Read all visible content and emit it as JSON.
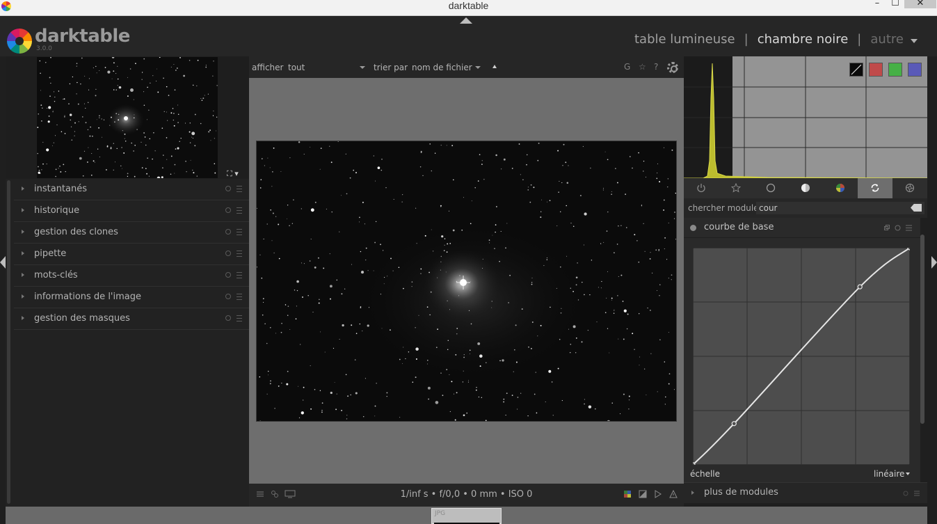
{
  "window": {
    "title": "darktable",
    "controls": [
      "minimize-icon",
      "maximize-icon",
      "close-icon"
    ]
  },
  "header": {
    "app_name": "darktable",
    "version": "3.0.0",
    "views": {
      "lighttable": "table lumineuse",
      "darkroom": "chambre noire",
      "other": "autre",
      "separator": "|"
    },
    "active_view": "chambre noire"
  },
  "left_modules": [
    {
      "label": "instantanés"
    },
    {
      "label": "historique"
    },
    {
      "label": "gestion des clones"
    },
    {
      "label": "pipette"
    },
    {
      "label": "mots-clés"
    },
    {
      "label": "informations de l'image"
    },
    {
      "label": "gestion des masques"
    }
  ],
  "toolbar_top": {
    "show_label": "afficher",
    "show_value": "tout",
    "sort_label": "trier par",
    "sort_value": "nom de fichier",
    "grouping_icon_text": "G",
    "star_icon_text": "☆",
    "help_icon_text": "?"
  },
  "toolbar_bottom": {
    "exif": "1/inf s • f/0,0 • 0 mm • ISO 0"
  },
  "histogram": {
    "channel_buttons": [
      "linear-log-icon",
      "red-channel",
      "green-channel",
      "blue-channel"
    ],
    "colors": {
      "red": "#c04a4a",
      "green": "#46b046",
      "blue": "#5a5ab8",
      "fill": "#bcbc2e"
    }
  },
  "module_groups": [
    "power-icon",
    "star-icon",
    "circle-icon",
    "tone-icon",
    "color-icon",
    "correct-icon",
    "effect-icon"
  ],
  "active_group": 5,
  "search": {
    "label": "chercher module",
    "value": "cour"
  },
  "curve_module": {
    "title": "courbe de base",
    "scale_label": "échelle",
    "scale_value": "linéaire",
    "curve_points": [
      [
        0,
        0
      ],
      [
        0.19,
        0.19
      ],
      [
        0.77,
        0.82
      ],
      [
        1,
        1
      ]
    ]
  },
  "more_modules": {
    "label": "plus de modules"
  },
  "filmstrip": {
    "thumb_label": "JPG"
  }
}
